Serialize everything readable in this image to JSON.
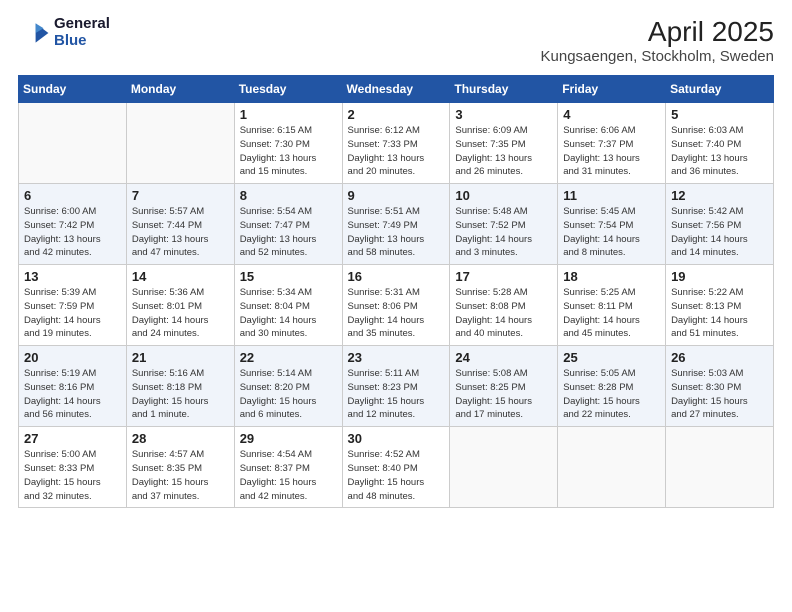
{
  "logo": {
    "general": "General",
    "blue": "Blue"
  },
  "title": "April 2025",
  "subtitle": "Kungsaengen, Stockholm, Sweden",
  "weekdays": [
    "Sunday",
    "Monday",
    "Tuesday",
    "Wednesday",
    "Thursday",
    "Friday",
    "Saturday"
  ],
  "weeks": [
    [
      {
        "day": "",
        "info": ""
      },
      {
        "day": "",
        "info": ""
      },
      {
        "day": "1",
        "info": "Sunrise: 6:15 AM\nSunset: 7:30 PM\nDaylight: 13 hours\nand 15 minutes."
      },
      {
        "day": "2",
        "info": "Sunrise: 6:12 AM\nSunset: 7:33 PM\nDaylight: 13 hours\nand 20 minutes."
      },
      {
        "day": "3",
        "info": "Sunrise: 6:09 AM\nSunset: 7:35 PM\nDaylight: 13 hours\nand 26 minutes."
      },
      {
        "day": "4",
        "info": "Sunrise: 6:06 AM\nSunset: 7:37 PM\nDaylight: 13 hours\nand 31 minutes."
      },
      {
        "day": "5",
        "info": "Sunrise: 6:03 AM\nSunset: 7:40 PM\nDaylight: 13 hours\nand 36 minutes."
      }
    ],
    [
      {
        "day": "6",
        "info": "Sunrise: 6:00 AM\nSunset: 7:42 PM\nDaylight: 13 hours\nand 42 minutes."
      },
      {
        "day": "7",
        "info": "Sunrise: 5:57 AM\nSunset: 7:44 PM\nDaylight: 13 hours\nand 47 minutes."
      },
      {
        "day": "8",
        "info": "Sunrise: 5:54 AM\nSunset: 7:47 PM\nDaylight: 13 hours\nand 52 minutes."
      },
      {
        "day": "9",
        "info": "Sunrise: 5:51 AM\nSunset: 7:49 PM\nDaylight: 13 hours\nand 58 minutes."
      },
      {
        "day": "10",
        "info": "Sunrise: 5:48 AM\nSunset: 7:52 PM\nDaylight: 14 hours\nand 3 minutes."
      },
      {
        "day": "11",
        "info": "Sunrise: 5:45 AM\nSunset: 7:54 PM\nDaylight: 14 hours\nand 8 minutes."
      },
      {
        "day": "12",
        "info": "Sunrise: 5:42 AM\nSunset: 7:56 PM\nDaylight: 14 hours\nand 14 minutes."
      }
    ],
    [
      {
        "day": "13",
        "info": "Sunrise: 5:39 AM\nSunset: 7:59 PM\nDaylight: 14 hours\nand 19 minutes."
      },
      {
        "day": "14",
        "info": "Sunrise: 5:36 AM\nSunset: 8:01 PM\nDaylight: 14 hours\nand 24 minutes."
      },
      {
        "day": "15",
        "info": "Sunrise: 5:34 AM\nSunset: 8:04 PM\nDaylight: 14 hours\nand 30 minutes."
      },
      {
        "day": "16",
        "info": "Sunrise: 5:31 AM\nSunset: 8:06 PM\nDaylight: 14 hours\nand 35 minutes."
      },
      {
        "day": "17",
        "info": "Sunrise: 5:28 AM\nSunset: 8:08 PM\nDaylight: 14 hours\nand 40 minutes."
      },
      {
        "day": "18",
        "info": "Sunrise: 5:25 AM\nSunset: 8:11 PM\nDaylight: 14 hours\nand 45 minutes."
      },
      {
        "day": "19",
        "info": "Sunrise: 5:22 AM\nSunset: 8:13 PM\nDaylight: 14 hours\nand 51 minutes."
      }
    ],
    [
      {
        "day": "20",
        "info": "Sunrise: 5:19 AM\nSunset: 8:16 PM\nDaylight: 14 hours\nand 56 minutes."
      },
      {
        "day": "21",
        "info": "Sunrise: 5:16 AM\nSunset: 8:18 PM\nDaylight: 15 hours\nand 1 minute."
      },
      {
        "day": "22",
        "info": "Sunrise: 5:14 AM\nSunset: 8:20 PM\nDaylight: 15 hours\nand 6 minutes."
      },
      {
        "day": "23",
        "info": "Sunrise: 5:11 AM\nSunset: 8:23 PM\nDaylight: 15 hours\nand 12 minutes."
      },
      {
        "day": "24",
        "info": "Sunrise: 5:08 AM\nSunset: 8:25 PM\nDaylight: 15 hours\nand 17 minutes."
      },
      {
        "day": "25",
        "info": "Sunrise: 5:05 AM\nSunset: 8:28 PM\nDaylight: 15 hours\nand 22 minutes."
      },
      {
        "day": "26",
        "info": "Sunrise: 5:03 AM\nSunset: 8:30 PM\nDaylight: 15 hours\nand 27 minutes."
      }
    ],
    [
      {
        "day": "27",
        "info": "Sunrise: 5:00 AM\nSunset: 8:33 PM\nDaylight: 15 hours\nand 32 minutes."
      },
      {
        "day": "28",
        "info": "Sunrise: 4:57 AM\nSunset: 8:35 PM\nDaylight: 15 hours\nand 37 minutes."
      },
      {
        "day": "29",
        "info": "Sunrise: 4:54 AM\nSunset: 8:37 PM\nDaylight: 15 hours\nand 42 minutes."
      },
      {
        "day": "30",
        "info": "Sunrise: 4:52 AM\nSunset: 8:40 PM\nDaylight: 15 hours\nand 48 minutes."
      },
      {
        "day": "",
        "info": ""
      },
      {
        "day": "",
        "info": ""
      },
      {
        "day": "",
        "info": ""
      }
    ]
  ]
}
